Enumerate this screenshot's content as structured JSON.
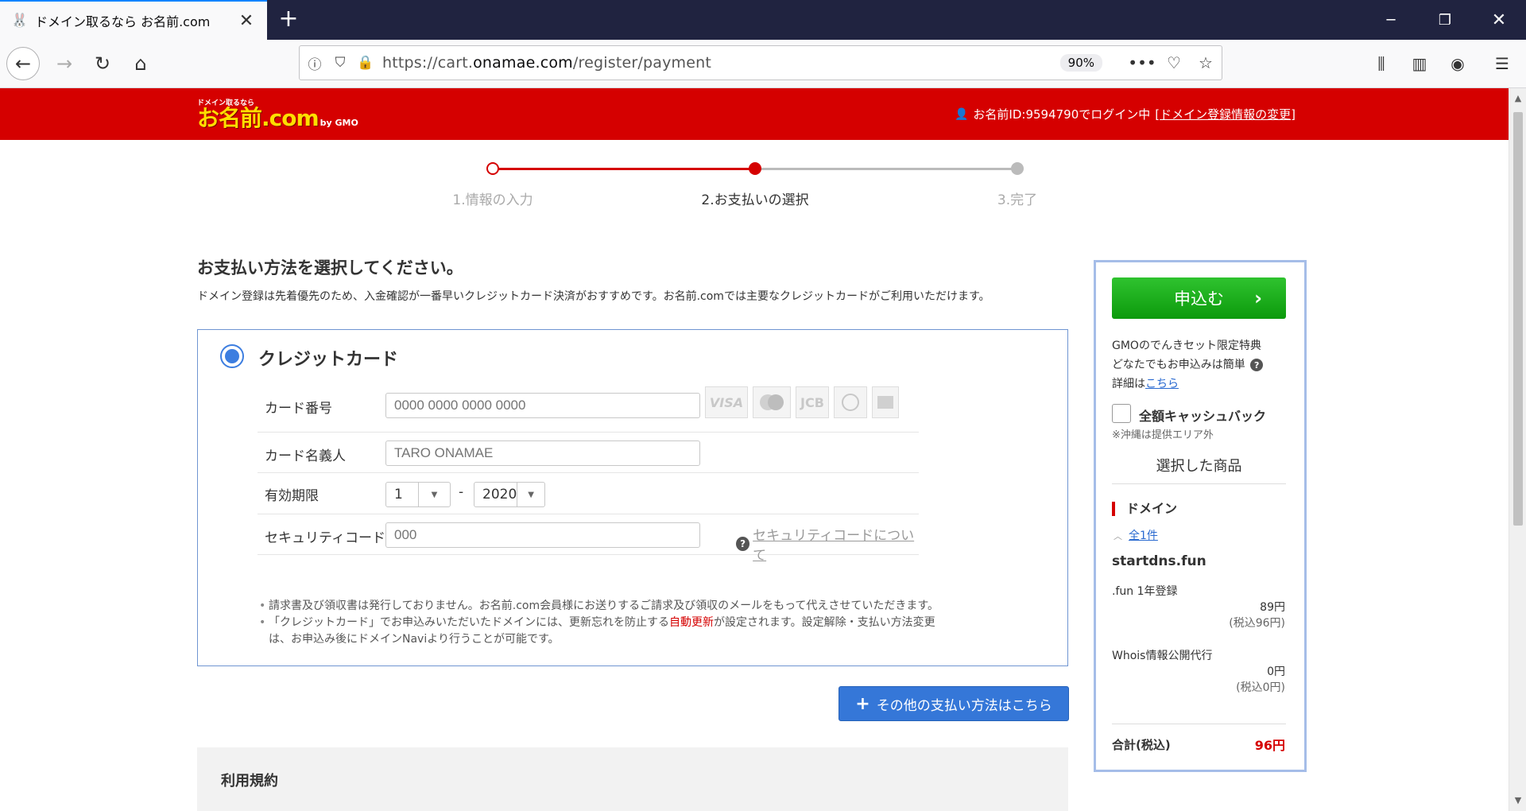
{
  "browser": {
    "tab_title": "ドメイン取るなら お名前.com",
    "url_prefix": "https://cart.",
    "url_domain": "onamae.com",
    "url_path": "/register/payment",
    "zoom": "90%"
  },
  "header": {
    "logo_small": "ドメイン取るなら",
    "logo_main": "お名前.com",
    "logo_by": "by GMO",
    "login_text": "お名前ID:9594790でログイン中",
    "login_link": "ドメイン登録情報の変更"
  },
  "steps": [
    {
      "label": "1.情報の入力",
      "state": "done"
    },
    {
      "label": "2.お支払いの選択",
      "state": "current"
    },
    {
      "label": "3.完了",
      "state": "todo"
    }
  ],
  "main": {
    "title": "お支払い方法を選択してください。",
    "description": "ドメイン登録は先着優先のため、入金確認が一番早いクレジットカード決済がおすすめです。お名前.comでは主要なクレジットカードがご利用いただけます。"
  },
  "credit_card": {
    "title": "クレジットカード",
    "card_number_label": "カード番号",
    "card_number_placeholder": "0000 0000 0000 0000",
    "card_logos": [
      "VISA",
      "MC",
      "JCB",
      "Diners",
      "AMEX"
    ],
    "holder_label": "カード名義人",
    "holder_placeholder": "TARO ONAMAE",
    "expiry_label": "有効期限",
    "expiry_month": "1",
    "expiry_sep": "-",
    "expiry_year": "2020",
    "security_label": "セキュリティコード",
    "security_placeholder": "000",
    "security_help": "セキュリティコードについて",
    "note1": "請求書及び領収書は発行しておりません。お名前.com会員様にお送りするご請求及び領収のメールをもって代えさせていただきます。",
    "note2_a": "「クレジットカード」でお申込みいただいたドメインには、更新忘れを防止する",
    "note2_red": "自動更新",
    "note2_b": "が設定されます。設定解除・支払い方法変更",
    "note2_c": "は、お申込み後にドメインNaviより行うことが可能です。"
  },
  "other_payment": "その他の支払い方法はこちら",
  "terms_title": "利用規約",
  "sidebar": {
    "apply": "申込む",
    "promo1": "GMOのでんきセット限定特典",
    "promo2": "どなたでもお申込みは簡単",
    "promo3_a": "詳細は",
    "promo3_link": "こちら",
    "cashback": "全額キャッシュバック",
    "cashback_note": "※沖縄は提供エリア外",
    "selected_title": "選択した商品",
    "domain_head": "ドメイン",
    "all_count": "全1件",
    "domain_name": "startdns.fun",
    "items": [
      {
        "name": ".fun 1年登録",
        "price": "89円",
        "tax": "(税込96円)"
      },
      {
        "name": "Whois情報公開代行",
        "price": "0円",
        "tax": "(税込0円)"
      }
    ],
    "total_label": "合計(税込)",
    "total_value": "96円"
  }
}
